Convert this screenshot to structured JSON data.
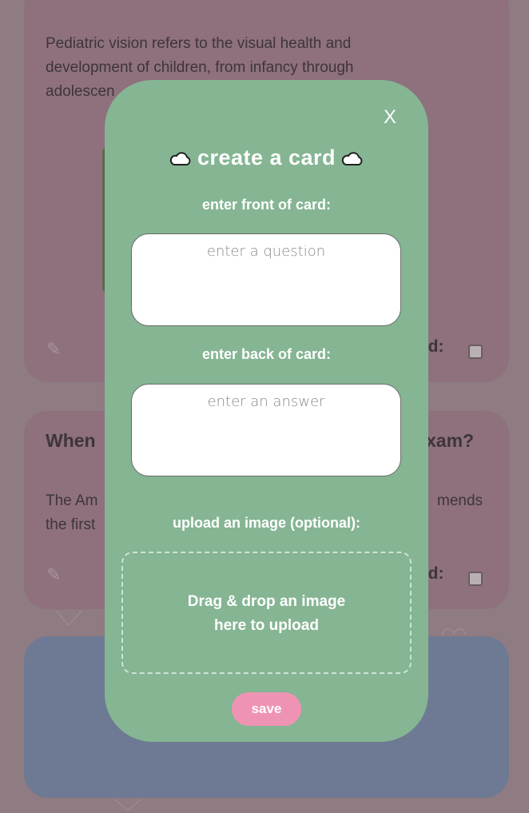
{
  "background": {
    "card1": {
      "body_line1": "Pediatric vision refers to the visual health and",
      "body_line2": "development of children, from infancy through",
      "body_line3": "adolescen",
      "studied_label": "ed:"
    },
    "card2": {
      "question_left": "When",
      "question_right": "xam?",
      "body_left_line1": "The Am",
      "body_left_line2": "the first",
      "body_right_line1": "mends",
      "studied_label": "ed:"
    }
  },
  "modal": {
    "close_label": "X",
    "title": "create a card",
    "front_label": "enter front of card:",
    "front_placeholder": "enter a question",
    "back_label": "enter back of card:",
    "back_placeholder": "enter an answer",
    "upload_label": "upload an image (optional):",
    "dropzone_line1": "Drag & drop an image",
    "dropzone_line2": "here to upload",
    "save_label": "save"
  },
  "colors": {
    "modal_bg": "#85b593",
    "save_button": "#ef93b4",
    "overlay_bg": "#8f7b82"
  },
  "icons": {
    "title_left": "cloud-icon",
    "title_right": "cloud-icon",
    "edit": "pencil-icon"
  }
}
